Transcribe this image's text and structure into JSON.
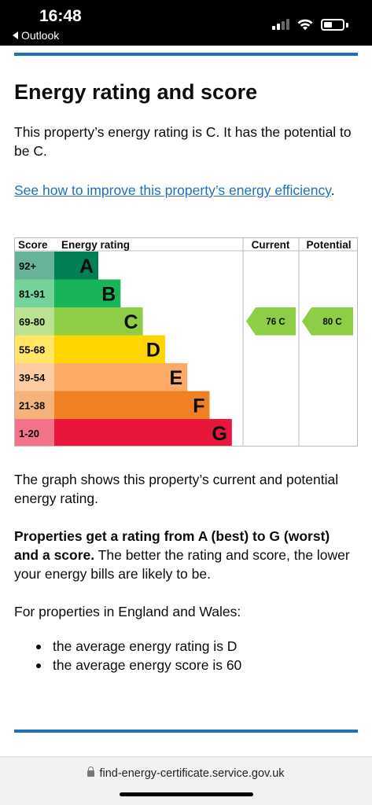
{
  "status": {
    "time": "16:48",
    "back_app": "Outlook"
  },
  "page": {
    "title": "Energy rating and score",
    "intro": "This property’s energy rating is C. It has the potential to be C.",
    "improve_link": "See how to improve this property’s energy efficiency",
    "improve_suffix": ".",
    "graph_note": "The graph shows this property’s current and potential energy rating.",
    "rating_bold": "Properties get a rating from A (best) to G (worst) and a score.",
    "rating_rest": " The better the rating and score, the lower your energy bills are likely to be.",
    "england_wales": "For properties in England and Wales:",
    "averages": [
      "the average energy rating is D",
      "the average energy score is 60"
    ]
  },
  "chart_data": {
    "type": "bar",
    "headers": {
      "score": "Score",
      "rating": "Energy rating",
      "current": "Current",
      "potential": "Potential"
    },
    "bands": [
      {
        "score": "92+",
        "letter": "A",
        "color": "#008054",
        "score_bg": "#66b398"
      },
      {
        "score": "81-91",
        "letter": "B",
        "color": "#19b459",
        "score_bg": "#75d29b"
      },
      {
        "score": "69-80",
        "letter": "C",
        "color": "#8dce46",
        "score_bg": "#bbe290"
      },
      {
        "score": "55-68",
        "letter": "D",
        "color": "#ffd500",
        "score_bg": "#ffe666"
      },
      {
        "score": "39-54",
        "letter": "E",
        "color": "#fcaa65",
        "score_bg": "#fdcca3"
      },
      {
        "score": "21-38",
        "letter": "F",
        "color": "#ef8023",
        "score_bg": "#f5b37b"
      },
      {
        "score": "1-20",
        "letter": "G",
        "color": "#e9153b",
        "score_bg": "#f27389"
      }
    ],
    "current": {
      "value": 76,
      "letter": "C",
      "label": "76 C",
      "color": "#8dce46"
    },
    "potential": {
      "value": 80,
      "letter": "C",
      "label": "80 C",
      "color": "#8dce46"
    }
  },
  "browser": {
    "url": "find-energy-certificate.service.gov.uk"
  }
}
